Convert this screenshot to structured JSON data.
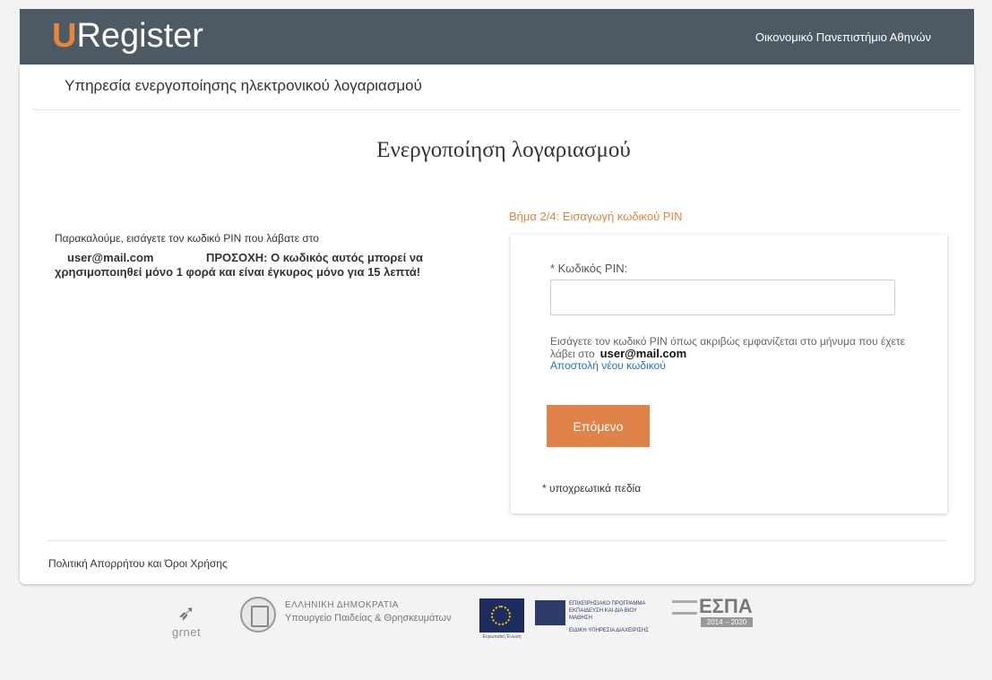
{
  "header": {
    "logo_u": "U",
    "logo_rest": "Register",
    "institution": "Οικονομικό Πανεπιστήμιο Αθηνών"
  },
  "service_title": "Υπηρεσία ενεργοποίησης ηλεκτρονικού λογαριασμού",
  "main_title": "Ενεργοποίηση λογαριασμού",
  "instructions": {
    "line1": "Παρακαλούμε, εισάγετε τον κωδικό PIN που λάβατε στο",
    "email": "user@mail.com",
    "warning": "ΠΡΟΣΟΧΗ: Ο κωδικός αυτός μπορεί να χρησιμοποιηθεί μόνο 1 φορά και είναι έγκυρος μόνο για 15 λεπτά!"
  },
  "step": "Βήμα 2/4: Εισαγωγή κωδικού PIN",
  "form": {
    "pin_label": "* Κωδικός PIN:",
    "pin_value": "",
    "pin_placeholder": "",
    "help_text": "Εισάγετε τον κωδικό PIN όπως ακριβώς εμφανίζεται στο μήνυμα που έχετε λάβει στο",
    "help_email": "user@mail.com",
    "resend_link": "Αποστολή νέου κωδικού",
    "next_button": "Επόμενο",
    "required_note": "* υποχρεωτικά πεδία"
  },
  "footer": {
    "privacy_link": "Πολιτική Απορρήτου και Όροι Χρήσης"
  },
  "logos": {
    "grnet": "grnet",
    "ministry_line1": "ΕΛΛΗΝΙΚΗ ΔΗΜΟΚΡΑΤΙΑ",
    "ministry_line2": "Υπουργείο Παιδείας & Θρησκευμάτων",
    "eu_caption": "Ευρωπαϊκή Ένωση",
    "epal_line1": "ΕΠΙΧΕΙΡΗΣΙΑΚΟ ΠΡΟΓΡΑΜΜΑ",
    "epal_line2": "ΕΚΠΑΙΔΕΥΣΗ ΚΑΙ ΔΙΑ ΒΙΟΥ ΜΑΘΗΣΗ",
    "epal_line3": "ΕΙΔΙΚΗ ΥΠΗΡΕΣΙΑ ΔΙΑΧΕΙΡΙΣΗΣ",
    "espa_title": "ΕΣΠΑ",
    "espa_years": "2014 – 2020"
  },
  "colors": {
    "header_bg": "#4e5a63",
    "accent": "#e0834a",
    "link": "#2a6fb2"
  }
}
